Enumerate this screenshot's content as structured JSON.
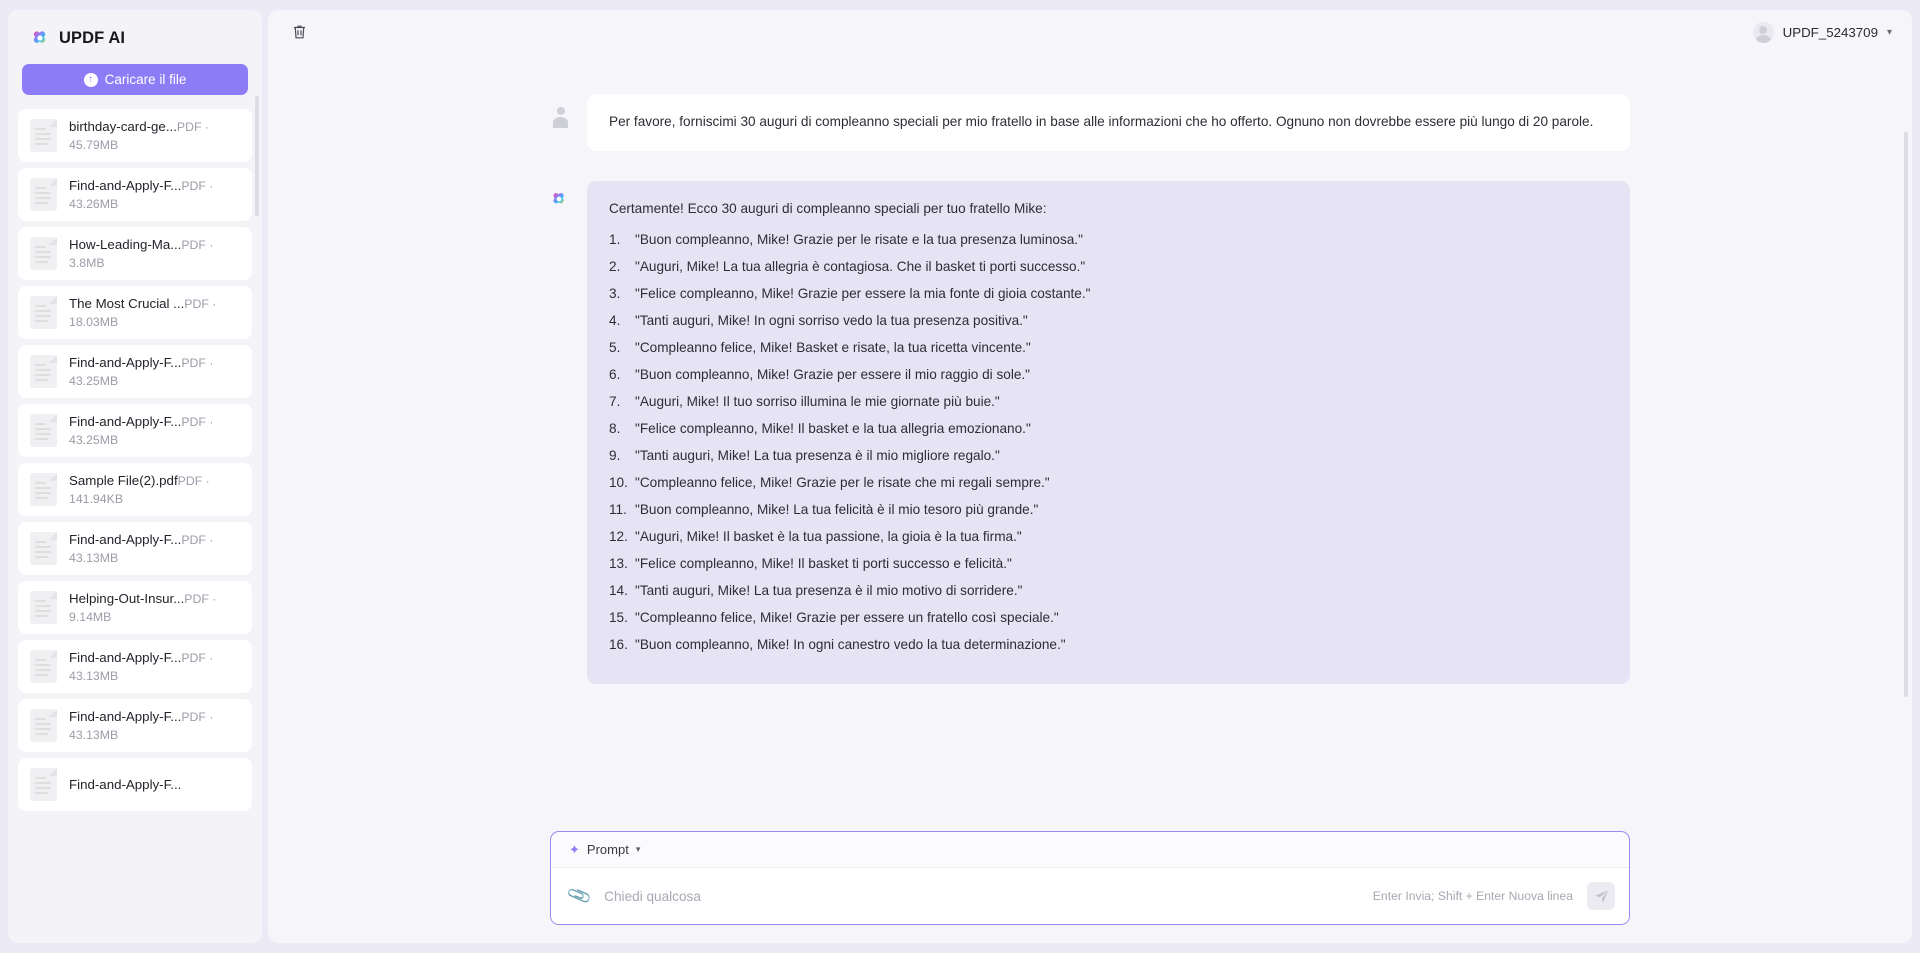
{
  "sidebar": {
    "brand": {
      "title": "UPDF AI",
      "logo_icon": "updf-logo-icon"
    },
    "upload_button": {
      "label": "Caricare il file",
      "icon": "upload-circle-icon"
    },
    "files": [
      {
        "name": "birthday-card-ge...",
        "meta": "PDF · 45.79MB"
      },
      {
        "name": "Find-and-Apply-F...",
        "meta": "PDF · 43.26MB"
      },
      {
        "name": "How-Leading-Ma...",
        "meta": "PDF · 3.8MB"
      },
      {
        "name": "The Most Crucial ...",
        "meta": "PDF · 18.03MB"
      },
      {
        "name": "Find-and-Apply-F...",
        "meta": "PDF · 43.25MB"
      },
      {
        "name": "Find-and-Apply-F...",
        "meta": "PDF · 43.25MB"
      },
      {
        "name": "Sample File(2).pdf",
        "meta": "PDF · 141.94KB"
      },
      {
        "name": "Find-and-Apply-F...",
        "meta": "PDF · 43.13MB"
      },
      {
        "name": "Helping-Out-Insur...",
        "meta": "PDF · 9.14MB"
      },
      {
        "name": "Find-and-Apply-F...",
        "meta": "PDF · 43.13MB"
      },
      {
        "name": "Find-and-Apply-F...",
        "meta": "PDF · 43.13MB"
      },
      {
        "name": "Find-and-Apply-F...",
        "meta": ""
      }
    ]
  },
  "topbar": {
    "delete_icon": "trash-icon",
    "user": {
      "name": "UPDF_5243709",
      "avatar_icon": "avatar-icon",
      "caret_icon": "chevron-down-icon"
    }
  },
  "conversation": {
    "user_message": "Per favore, forniscimi 30 auguri di compleanno speciali per mio fratello in base alle informazioni che ho offerto. Ognuno non dovrebbe essere più lungo di 20 parole.",
    "ai_intro": "Certamente! Ecco 30 auguri di compleanno speciali per tuo fratello Mike:",
    "ai_items": [
      "\"Buon compleanno, Mike! Grazie per le risate e la tua presenza luminosa.\"",
      "\"Auguri, Mike! La tua allegria è contagiosa. Che il basket ti porti successo.\"",
      "\"Felice compleanno, Mike! Grazie per essere la mia fonte di gioia costante.\"",
      "\"Tanti auguri, Mike! In ogni sorriso vedo la tua presenza positiva.\"",
      "\"Compleanno felice, Mike! Basket e risate, la tua ricetta vincente.\"",
      "\"Buon compleanno, Mike! Grazie per essere il mio raggio di sole.\"",
      "\"Auguri, Mike! Il tuo sorriso illumina le mie giornate più buie.\"",
      "\"Felice compleanno, Mike! Il basket e la tua allegria emozionano.\"",
      "\"Tanti auguri, Mike! La tua presenza è il mio migliore regalo.\"",
      "\"Compleanno felice, Mike! Grazie per le risate che mi regali sempre.\"",
      "\"Buon compleanno, Mike! La tua felicità è il mio tesoro più grande.\"",
      "\"Auguri, Mike! Il basket è la tua passione, la gioia è la tua firma.\"",
      "\"Felice compleanno, Mike! Il basket ti porti successo e felicità.\"",
      "\"Tanti auguri, Mike! La tua presenza è il mio motivo di sorridere.\"",
      "\"Compleanno felice, Mike! Grazie per essere un fratello così speciale.\"",
      "\"Buon compleanno, Mike! In ogni canestro vedo la tua determinazione.\""
    ]
  },
  "composer": {
    "prompt_label": "Prompt",
    "prompt_icon": "sparkle-icon",
    "caret_icon": "caret-down-icon",
    "attach_icon": "paperclip-icon",
    "input_value": "",
    "placeholder": "Chiedi qualcosa",
    "hint": "Enter Invia; Shift + Enter Nuova linea",
    "send_icon": "send-icon"
  },
  "colors": {
    "accent": "#8d7cf6",
    "ai_bubble": "#e5e3f4",
    "page_bg": "#eceaf5",
    "panel_bg": "#f6f5f9"
  }
}
